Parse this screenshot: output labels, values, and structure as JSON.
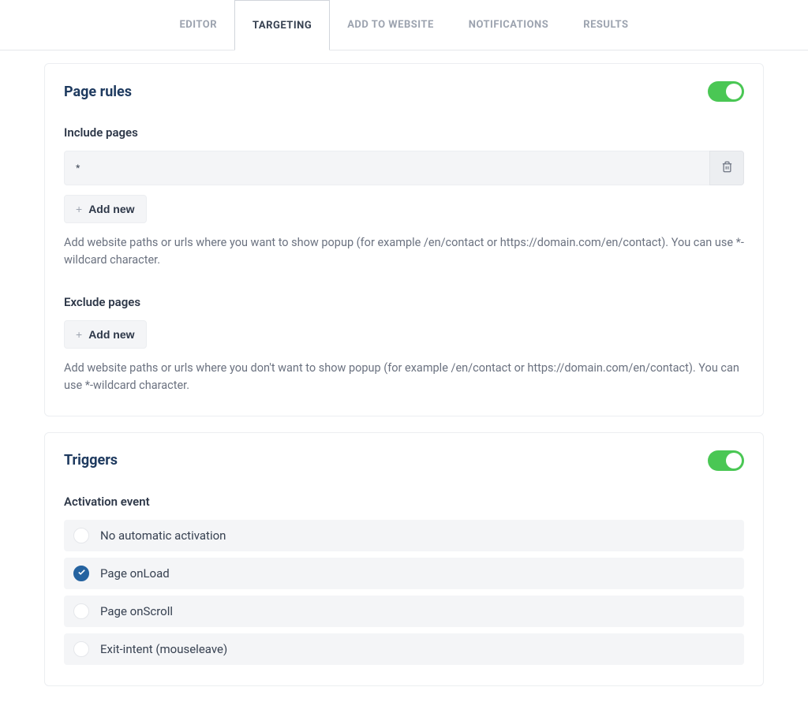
{
  "tabs": {
    "editor": "EDITOR",
    "targeting": "TARGETING",
    "add_to_website": "ADD TO WEBSITE",
    "notifications": "NOTIFICATIONS",
    "results": "RESULTS"
  },
  "page_rules": {
    "title": "Page rules",
    "include_label": "Include pages",
    "include_value": "*",
    "add_new": "Add new",
    "include_help": "Add website paths or urls where you want to show popup (for example /en/contact or https://domain.com/en/contact). You can use *-wildcard character.",
    "exclude_label": "Exclude pages",
    "exclude_help": "Add website paths or urls where you don't want to show popup (for example /en/contact or https://domain.com/en/contact). You can use *-wildcard character."
  },
  "triggers": {
    "title": "Triggers",
    "activation_label": "Activation event",
    "options": [
      {
        "label": "No automatic activation",
        "selected": false
      },
      {
        "label": "Page onLoad",
        "selected": true
      },
      {
        "label": "Page onScroll",
        "selected": false
      },
      {
        "label": "Exit-intent (mouseleave)",
        "selected": false
      }
    ]
  }
}
